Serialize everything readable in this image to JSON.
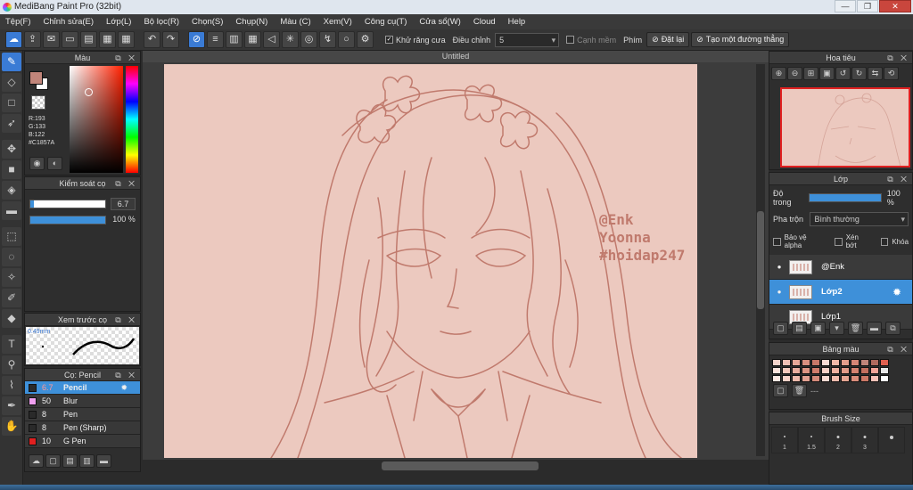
{
  "window": {
    "title": "MediBang Paint Pro (32bit)",
    "minimize": "—",
    "maximize": "❐",
    "close": "✕"
  },
  "menu": [
    "Tệp(F)",
    "Chỉnh sửa(E)",
    "Lớp(L)",
    "Bộ lọc(R)",
    "Chọn(S)",
    "Chụp(N)",
    "Màu (C)",
    "Xem(V)",
    "Công cụ(T)",
    "Cửa sổ(W)",
    "Cloud",
    "Help"
  ],
  "toolbar": {
    "antialias_label": "Khử răng cưa",
    "correction_label": "Điều chỉnh",
    "correction_value": "5",
    "smooth_edge_label": "Cạnh mềm",
    "keys_label": "Phím",
    "reset_label": "Đặt lại",
    "straight_line_label": "Tạo một đường thẳng"
  },
  "color_panel": {
    "title": "Màu",
    "r": "R:193",
    "g": "G:133",
    "b": "B:122",
    "hex": "#C1857A",
    "primary": "#c1857a",
    "secondary": "#ffffff"
  },
  "brush_control": {
    "title": "Kiểm soát cọ",
    "size_value": "6.7",
    "opacity_value": "100 %",
    "size_fill": 0.05,
    "opacity_fill": 1.0
  },
  "brush_preview": {
    "title": "Xem trước cọ",
    "size_text": "0.49mm"
  },
  "brush_list": {
    "title": "Cọ: Pencil",
    "items": [
      {
        "size": "6.7",
        "name": "Pencil",
        "color": "#2a2a2a"
      },
      {
        "size": "50",
        "name": "Blur",
        "color": "#f0a0f0"
      },
      {
        "size": "8",
        "name": "Pen",
        "color": "#2a2a2a"
      },
      {
        "size": "8",
        "name": "Pen (Sharp)",
        "color": "#2a2a2a"
      },
      {
        "size": "10",
        "name": "G Pen",
        "color": "#e02020"
      }
    ]
  },
  "document": {
    "tab_title": "Untitled",
    "watermark": [
      "@Enk",
      "Yoonna",
      "#hoidap247"
    ]
  },
  "navigator": {
    "title": "Hoa tiêu"
  },
  "layers": {
    "title": "Lớp",
    "opacity_label": "Độ trong",
    "opacity_value": "100 %",
    "blend_label": "Pha trộn",
    "blend_value": "Bình thường",
    "protect_alpha": "Bảo vệ alpha",
    "clipping": "Xén bớt",
    "lock": "Khóa",
    "items": [
      {
        "name": "@Enk"
      },
      {
        "name": "Lớp2"
      },
      {
        "name": "Lớp1"
      }
    ]
  },
  "palette": {
    "title": "Bảng màu",
    "colors": [
      "#f5d5cc",
      "#f0c0b5",
      "#e6a898",
      "#d99080",
      "#c87868",
      "#f8dcd5",
      "#f0b8a8",
      "#e49e8c",
      "#d68676",
      "#c1857a",
      "#b06a5e",
      "#e06050",
      "#fbe3dc",
      "#f3c8bc",
      "#e8ad9e",
      "#dc9483",
      "#cf7c6b",
      "#f7d0c6",
      "#eeb0a0",
      "#e29a88",
      "#d48270",
      "#c26f5e",
      "#f4a498",
      "#e8e8e8",
      "#fde9e3",
      "#f6d2c8",
      "#edb9ab",
      "#e1a091",
      "#d48a7a",
      "#f9dad2",
      "#f1bcae",
      "#e6a593",
      "#da8d7b",
      "#cb7866",
      "#fbc2b8",
      "#ffffff"
    ],
    "extra": "---"
  },
  "brush_size": {
    "title": "Brush Size",
    "labels": [
      "1",
      "1.5",
      "2",
      "3",
      ""
    ]
  }
}
